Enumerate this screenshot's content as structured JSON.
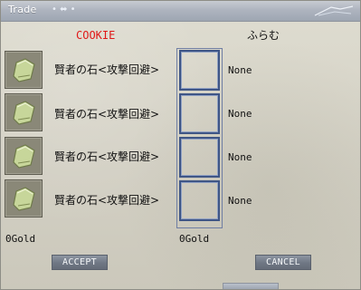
{
  "window": {
    "title": "Trade",
    "title_decoration": "• ⬌ •"
  },
  "trade": {
    "left_owner": "COOKIE",
    "right_owner": "ふらむ",
    "left_items": [
      {
        "name": "賢者の石<攻撃回避>",
        "icon": "green-stone-icon"
      },
      {
        "name": "賢者の石<攻撃回避>",
        "icon": "green-stone-icon"
      },
      {
        "name": "賢者の石<攻撃回避>",
        "icon": "green-stone-icon"
      },
      {
        "name": "賢者の石<攻撃回避>",
        "icon": "green-stone-icon"
      }
    ],
    "right_items": [
      {
        "name": "None"
      },
      {
        "name": "None"
      },
      {
        "name": "None"
      },
      {
        "name": "None"
      }
    ],
    "left_gold": "0Gold",
    "right_gold": "0Gold"
  },
  "buttons": {
    "accept": "ACCEPT",
    "cancel": "CANCEL"
  },
  "colors": {
    "left_owner": "#e01818",
    "slot_border": "#3f5686"
  }
}
